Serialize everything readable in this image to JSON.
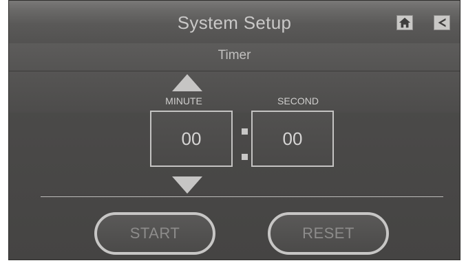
{
  "header": {
    "title": "System Setup",
    "home_icon": "home-icon",
    "back_icon": "back-arrow-icon"
  },
  "subheader": {
    "title": "Timer"
  },
  "timer": {
    "minute_label": "MINUTE",
    "second_label": "SECOND",
    "minute_value": "00",
    "second_value": "00",
    "increment_icon": "triangle-up-icon",
    "decrement_icon": "triangle-down-icon"
  },
  "actions": {
    "start_label": "START",
    "reset_label": "RESET"
  },
  "colors": {
    "background": "#4b4a49",
    "text": "#c9c8c7",
    "disabled_text": "#8d8c8b",
    "outline": "#c7c6c5"
  }
}
